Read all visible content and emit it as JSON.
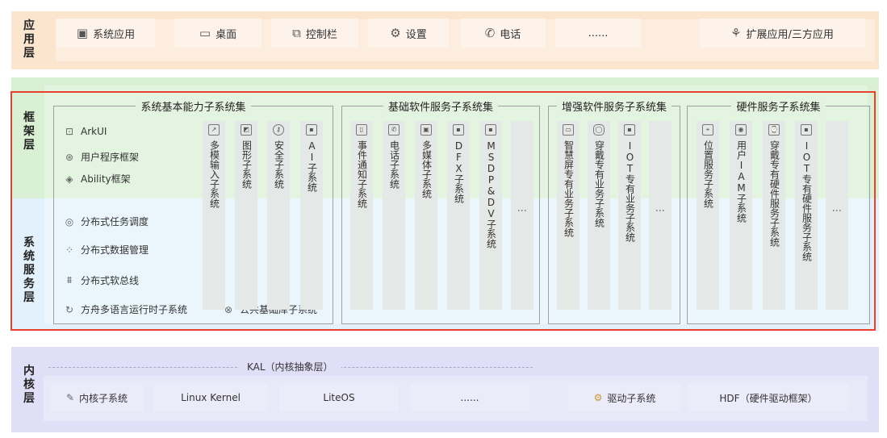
{
  "layers": {
    "app": "应用层",
    "framework": "框架层",
    "system_service": "系统服务层",
    "kernel": "内核层"
  },
  "app_layer": {
    "items": [
      {
        "icon": "app-grid-icon",
        "label": "系统应用"
      },
      {
        "icon": "monitor-icon",
        "label": "桌面"
      },
      {
        "icon": "control-bar-icon",
        "label": "控制栏"
      },
      {
        "icon": "gear-icon",
        "label": "设置"
      },
      {
        "icon": "phone-icon",
        "label": "电话"
      },
      {
        "icon": "",
        "label": "......"
      },
      {
        "icon": "extension-icon",
        "label": "扩展应用/三方应用"
      }
    ]
  },
  "groups": [
    {
      "title": "系统基本能力子系统集"
    },
    {
      "title": "基础软件服务子系统集"
    },
    {
      "title": "增强软件服务子系统集"
    },
    {
      "title": "硬件服务子系统集"
    }
  ],
  "basic_list": [
    {
      "icon": "ui-icon",
      "label": "ArkUI"
    },
    {
      "icon": "framework-icon",
      "label": "用户程序框架"
    },
    {
      "icon": "layers-icon",
      "label": "Ability框架"
    },
    {
      "icon": "task-schedule-icon",
      "label": "分布式任务调度"
    },
    {
      "icon": "data-manage-icon",
      "label": "分布式数据管理"
    },
    {
      "icon": "soft-bus-icon",
      "label": "分布式软总线"
    },
    {
      "icon": "runtime-icon",
      "label": "方舟多语言运行时子系统"
    },
    {
      "icon": "library-icon",
      "label": "公共基础库子系统"
    }
  ],
  "columns": {
    "basic": [
      "多模输入子系统",
      "图形子系统",
      "安全子系统",
      "AI子系统"
    ],
    "software": [
      "事件通知子系统",
      "电话子系统",
      "多媒体子系统",
      "DFX子系统",
      "MSDP&DV子系统",
      "⋮"
    ],
    "enhanced": [
      "智慧屏专有业务子系统",
      "穿戴专有业务子系统",
      "IOT专有业务子系统",
      "⋮"
    ],
    "hardware": [
      "位置服务子系统",
      "用户IAM子系统",
      "穿戴专有硬件服务子系统",
      "IOT专有硬件服务子系统",
      "⋮"
    ]
  },
  "kernel_layer": {
    "kal": "KAL（内核抽象层）",
    "items": [
      {
        "icon": "kernel-icon",
        "label": "内核子系统"
      },
      {
        "icon": "",
        "label": "Linux Kernel"
      },
      {
        "icon": "",
        "label": "LiteOS"
      },
      {
        "icon": "",
        "label": "......"
      },
      {
        "icon": "driver-icon",
        "label": "驱动子系统"
      },
      {
        "icon": "",
        "label": "HDF（硬件驱动框架）"
      }
    ]
  }
}
